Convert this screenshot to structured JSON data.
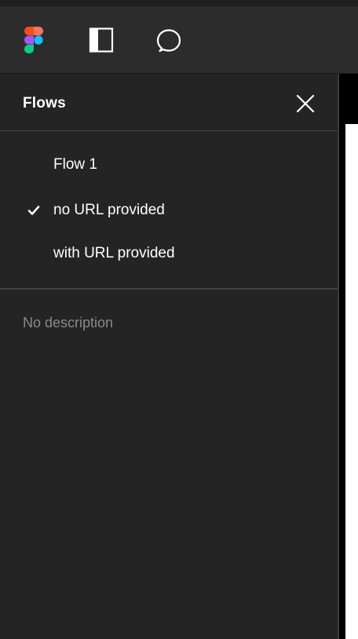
{
  "toolbar": {
    "icons": [
      "figma-logo-icon",
      "sidebar-panel-icon",
      "comment-icon"
    ]
  },
  "sidebar": {
    "title": "Flows",
    "flows": [
      {
        "label": "Flow 1",
        "selected": false
      },
      {
        "label": "no URL provided",
        "selected": true
      },
      {
        "label": "with URL provided",
        "selected": false
      }
    ],
    "description": "No description"
  },
  "colors": {
    "toolbar_bg": "#2c2c2c",
    "sidebar_bg": "#242424",
    "text_primary": "#ffffff",
    "text_muted": "#8a8a8a",
    "figma_red": "#f24e1e",
    "figma_orange": "#ff7262",
    "figma_purple": "#a259ff",
    "figma_blue": "#1abcfe",
    "figma_green": "#0acf83"
  }
}
